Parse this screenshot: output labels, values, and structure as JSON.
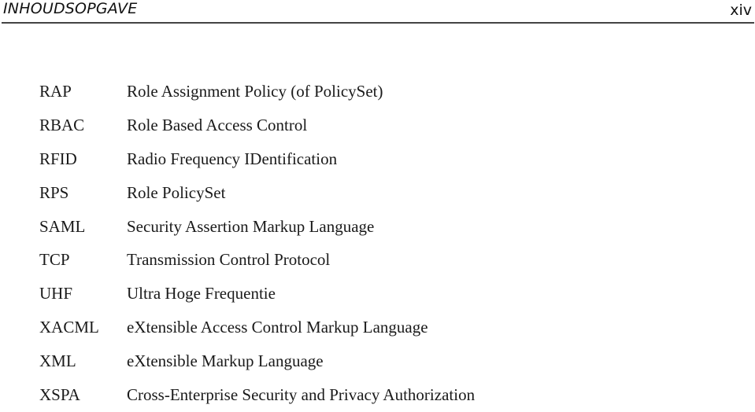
{
  "header": {
    "title": "INHOUDSOPGAVE",
    "page_number": "xiv"
  },
  "abbreviations": [
    {
      "abbr": "RAP",
      "definition": "Role Assignment Policy (of PolicySet)"
    },
    {
      "abbr": "RBAC",
      "definition": "Role Based Access Control"
    },
    {
      "abbr": "RFID",
      "definition": "Radio Frequency IDentification"
    },
    {
      "abbr": "RPS",
      "definition": "Role PolicySet"
    },
    {
      "abbr": "SAML",
      "definition": "Security Assertion Markup Language"
    },
    {
      "abbr": "TCP",
      "definition": "Transmission Control Protocol"
    },
    {
      "abbr": "UHF",
      "definition": "Ultra Hoge Frequentie"
    },
    {
      "abbr": "XACML",
      "definition": "eXtensible Access Control Markup Language"
    },
    {
      "abbr": "XML",
      "definition": "eXtensible Markup Language"
    },
    {
      "abbr": "XSPA",
      "definition": "Cross-Enterprise Security and Privacy Authorization"
    }
  ]
}
